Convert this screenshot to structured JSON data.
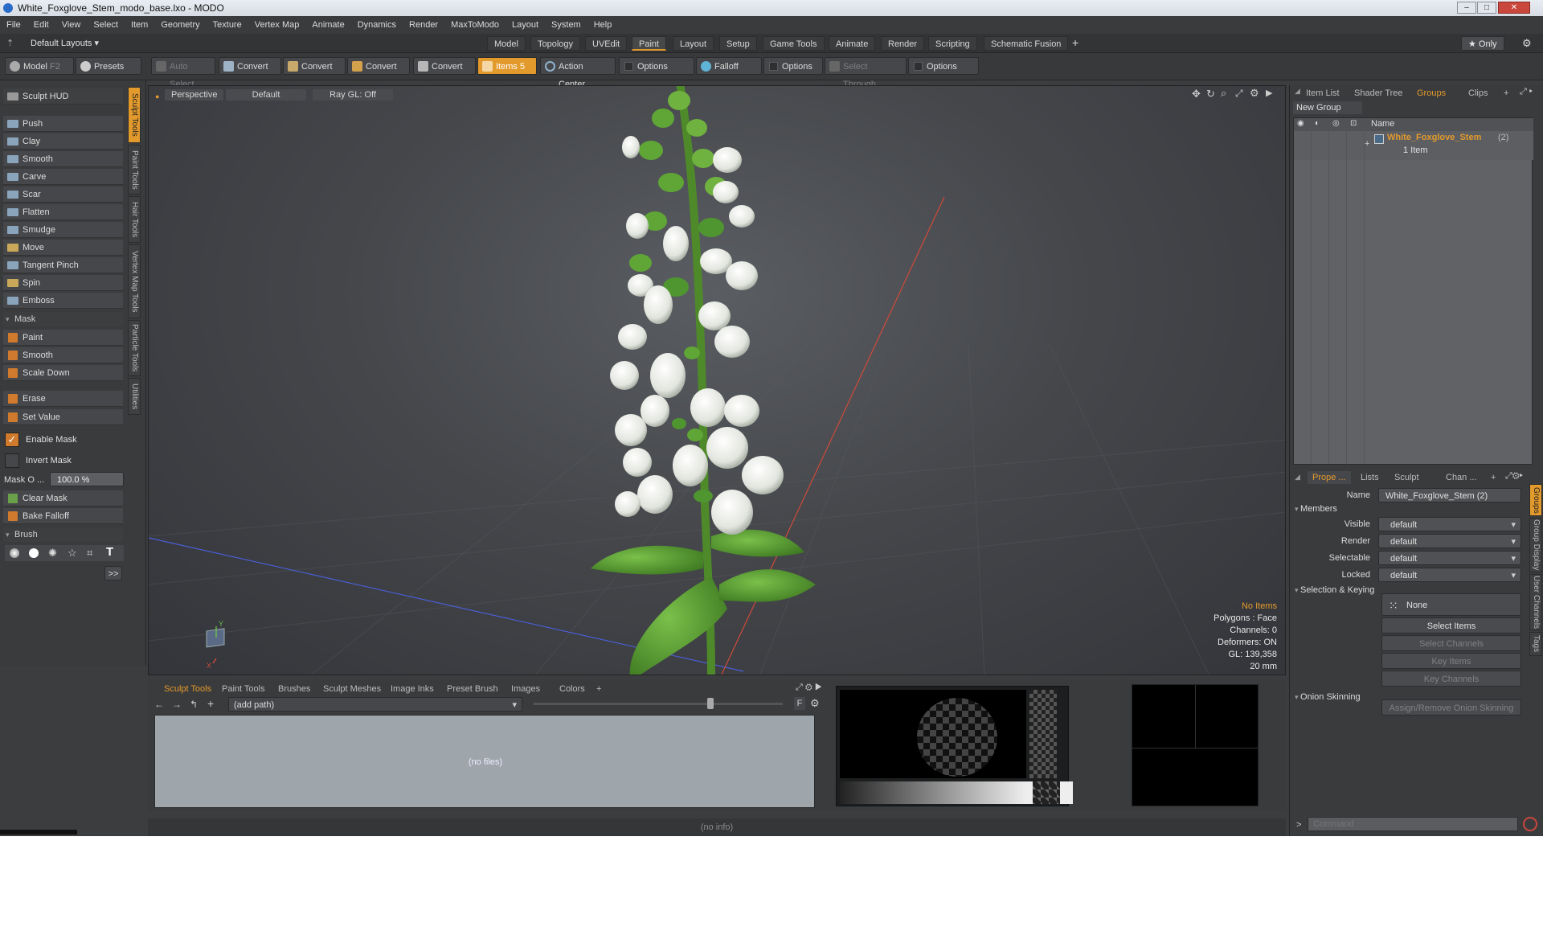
{
  "window": {
    "title": "White_Foxglove_Stem_modo_base.lxo - MODO"
  },
  "menubar": [
    "File",
    "Edit",
    "View",
    "Select",
    "Item",
    "Geometry",
    "Texture",
    "Vertex Map",
    "Animate",
    "Dynamics",
    "Render",
    "MaxToModo",
    "Layout",
    "System",
    "Help"
  ],
  "layoutbar": {
    "layouts_label": "Default Layouts ▾",
    "tabs": [
      "Model",
      "Topology",
      "UVEdit",
      "Paint",
      "Layout",
      "Setup",
      "Game Tools",
      "Animate",
      "Render",
      "Scripting",
      "Schematic Fusion"
    ],
    "active_tab": "Paint",
    "add_label": "+",
    "only_label": "★ Only"
  },
  "toolbar": {
    "model": "Model",
    "model_key": "F2",
    "presets": "Presets",
    "presets_key": "F6",
    "auto_select": "Auto Select",
    "convert1": "Convert",
    "convert2": "Convert",
    "convert3": "Convert",
    "convert4": "Convert",
    "items": "Items",
    "items_key": "5",
    "action_center": "Action Center",
    "options1": "Options",
    "falloff": "Falloff",
    "options2": "Options",
    "select_through": "Select Through",
    "options3": "Options"
  },
  "left": {
    "hud": "Sculpt HUD",
    "tools": [
      "Push",
      "Clay",
      "Smooth",
      "Carve",
      "Scar",
      "Flatten",
      "Smudge",
      "Move",
      "Tangent Pinch",
      "Spin",
      "Emboss"
    ],
    "mask_header": "Mask",
    "mask_tools": [
      "Paint",
      "Smooth",
      "Scale Down"
    ],
    "erase": "Erase",
    "set_value": "Set Value",
    "enable_mask": "Enable Mask",
    "invert_mask": "Invert Mask",
    "mask_opacity_label": "Mask O ...",
    "mask_opacity_value": "100.0 %",
    "clear_mask": "Clear Mask",
    "bake_falloff": "Bake Falloff",
    "brush_header": "Brush",
    "more": ">>",
    "vtabs": [
      "Sculpt Tools",
      "Paint Tools",
      "Hair Tools",
      "Vertex Map Tools",
      "Particle Tools",
      "Utilities"
    ]
  },
  "viewport": {
    "view": "Perspective",
    "shading": "Default",
    "raygl": "Ray GL: Off",
    "stats": [
      "No Items",
      "Polygons : Face",
      "Channels: 0",
      "Deformers: ON",
      "GL: 139,358",
      "20 mm"
    ]
  },
  "bottom": {
    "tabs": [
      "Sculpt Tools",
      "Paint Tools",
      "Brushes",
      "Sculpt Meshes",
      "Image Inks",
      "Preset Brush",
      "Images",
      "Colors",
      "+"
    ],
    "active_tab": "Sculpt Tools",
    "path": "(add path)",
    "no_files": "(no files)",
    "f_label": "F"
  },
  "status": {
    "text": "(no info)"
  },
  "right": {
    "top_tabs": [
      "Item List",
      "Shader Tree",
      "Groups",
      "Clips",
      "+"
    ],
    "active_top_tab": "Groups",
    "new_group": "New Group",
    "col_name": "Name",
    "group_name": "White_Foxglove_Stem",
    "group_count": "(2)",
    "group_sub": "1 Item",
    "prop_tabs": [
      "Prope ...",
      "Lists",
      "Sculpt",
      "Chan ...",
      "+"
    ],
    "active_prop_tab": "Prope ...",
    "name_label": "Name",
    "name_value": "White_Foxglove_Stem (2)",
    "members": "Members",
    "visible_label": "Visible",
    "visible_value": "default",
    "render_label": "Render",
    "render_value": "default",
    "selectable_label": "Selectable",
    "selectable_value": "default",
    "locked_label": "Locked",
    "locked_value": "default",
    "sel_keying": "Selection & Keying",
    "none": "None",
    "select_items": "Select Items",
    "select_channels": "Select Channels",
    "key_items": "Key Items",
    "key_channels": "Key Channels",
    "onion": "Onion Skinning",
    "assign_onion": "Assign/Remove Onion Skinning",
    "side_tabs": [
      "Groups",
      "Group Display",
      "User Channels",
      "Tags"
    ],
    "command_placeholder": "Command",
    "prompt": ">"
  },
  "colors": {
    "accent": "#e39a2c",
    "group_text": "#e39a2c",
    "stem_green": "#4f8a2a",
    "flower_white": "#eef0ea"
  }
}
